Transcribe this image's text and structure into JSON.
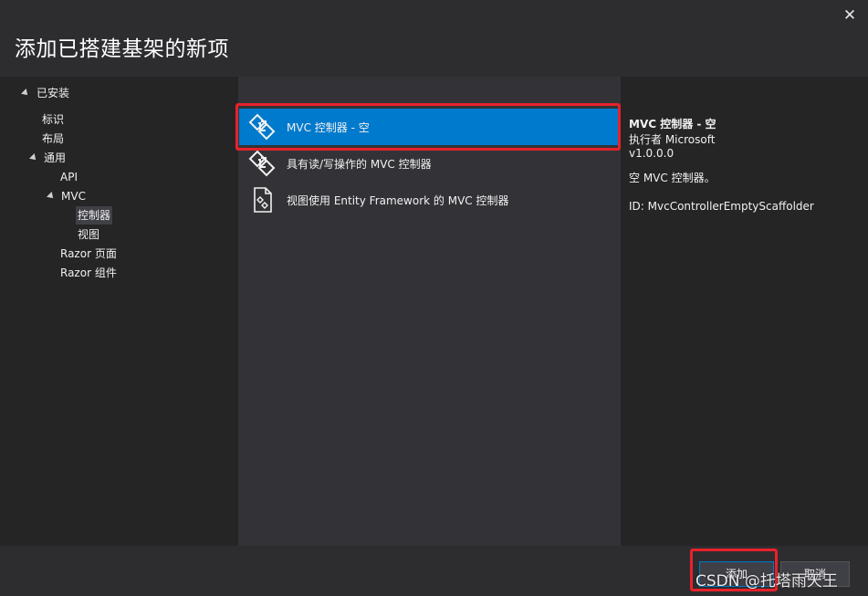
{
  "dialog": {
    "title": "添加已搭建基架的新项",
    "close_glyph": "✕"
  },
  "sidebar": {
    "installed_label": "已安装",
    "items": [
      {
        "label": "标识"
      },
      {
        "label": "布局"
      },
      {
        "label": "通用"
      },
      {
        "label": "API"
      },
      {
        "label": "MVC"
      },
      {
        "label": "控制器"
      },
      {
        "label": "视图"
      },
      {
        "label": "Razor 页面"
      },
      {
        "label": "Razor 组件"
      }
    ],
    "selected": "控制器"
  },
  "templates": [
    {
      "label": "MVC 控制器 - 空",
      "icon": "controller-icon",
      "selected": true
    },
    {
      "label": "具有读/写操作的 MVC 控制器",
      "icon": "controller-icon",
      "selected": false
    },
    {
      "label": "视图使用 Entity Framework 的 MVC 控制器",
      "icon": "document-controller-icon",
      "selected": false
    }
  ],
  "details": {
    "name": "MVC 控制器 - 空",
    "author": "执行者 Microsoft",
    "version": "v1.0.0.0",
    "description": "空 MVC 控制器。",
    "id": "ID: MvcControllerEmptyScaffolder"
  },
  "footer": {
    "add_label": "添加",
    "cancel_label": "取消"
  },
  "watermark": "CSDN @托塔雨天王",
  "colors": {
    "selection": "#007acc",
    "highlight": "#e8212a",
    "background": "#2d2d30"
  }
}
